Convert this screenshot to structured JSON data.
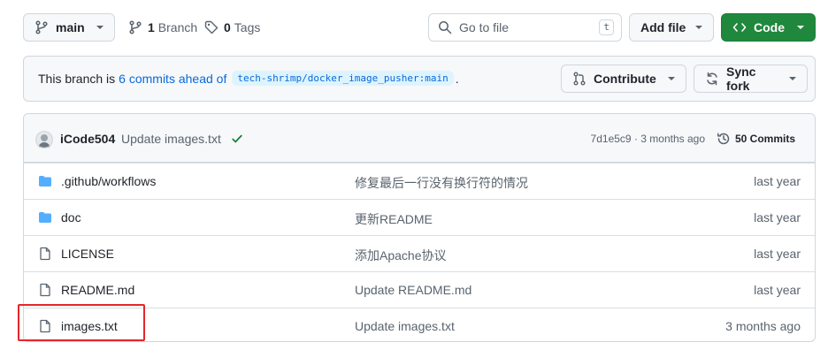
{
  "toolbar": {
    "branch_label": "main",
    "branches_count": "1",
    "branches_label": "Branch",
    "tags_count": "0",
    "tags_label": "Tags",
    "search_placeholder": "Go to file",
    "search_shortcut": "t",
    "add_file_label": "Add file",
    "code_label": "Code"
  },
  "banner": {
    "prefix": "This branch is",
    "link": "6 commits ahead of",
    "upstream": "tech-shrimp/docker_image_pusher:main",
    "suffix": ".",
    "contribute_label": "Contribute",
    "sync_label": "Sync fork"
  },
  "latest_commit": {
    "author": "iCode504",
    "message": "Update images.txt",
    "sha": "7d1e5c9",
    "time": "3 months ago",
    "commits_label": "50 Commits"
  },
  "files": [
    {
      "type": "folder",
      "name": ".github/workflows",
      "message": "修复最后一行没有换行符的情况",
      "time": "last year"
    },
    {
      "type": "folder",
      "name": "doc",
      "message": "更新README",
      "time": "last year"
    },
    {
      "type": "file",
      "name": "LICENSE",
      "message": "添加Apache协议",
      "time": "last year"
    },
    {
      "type": "file",
      "name": "README.md",
      "message": "Update README.md",
      "time": "last year"
    },
    {
      "type": "file",
      "name": "images.txt",
      "message": "Update images.txt",
      "time": "3 months ago"
    }
  ],
  "colors": {
    "accent": "#0969da",
    "code_button": "#1f883d",
    "highlight_box": "#e5262a",
    "folder_icon": "#54aeff"
  }
}
